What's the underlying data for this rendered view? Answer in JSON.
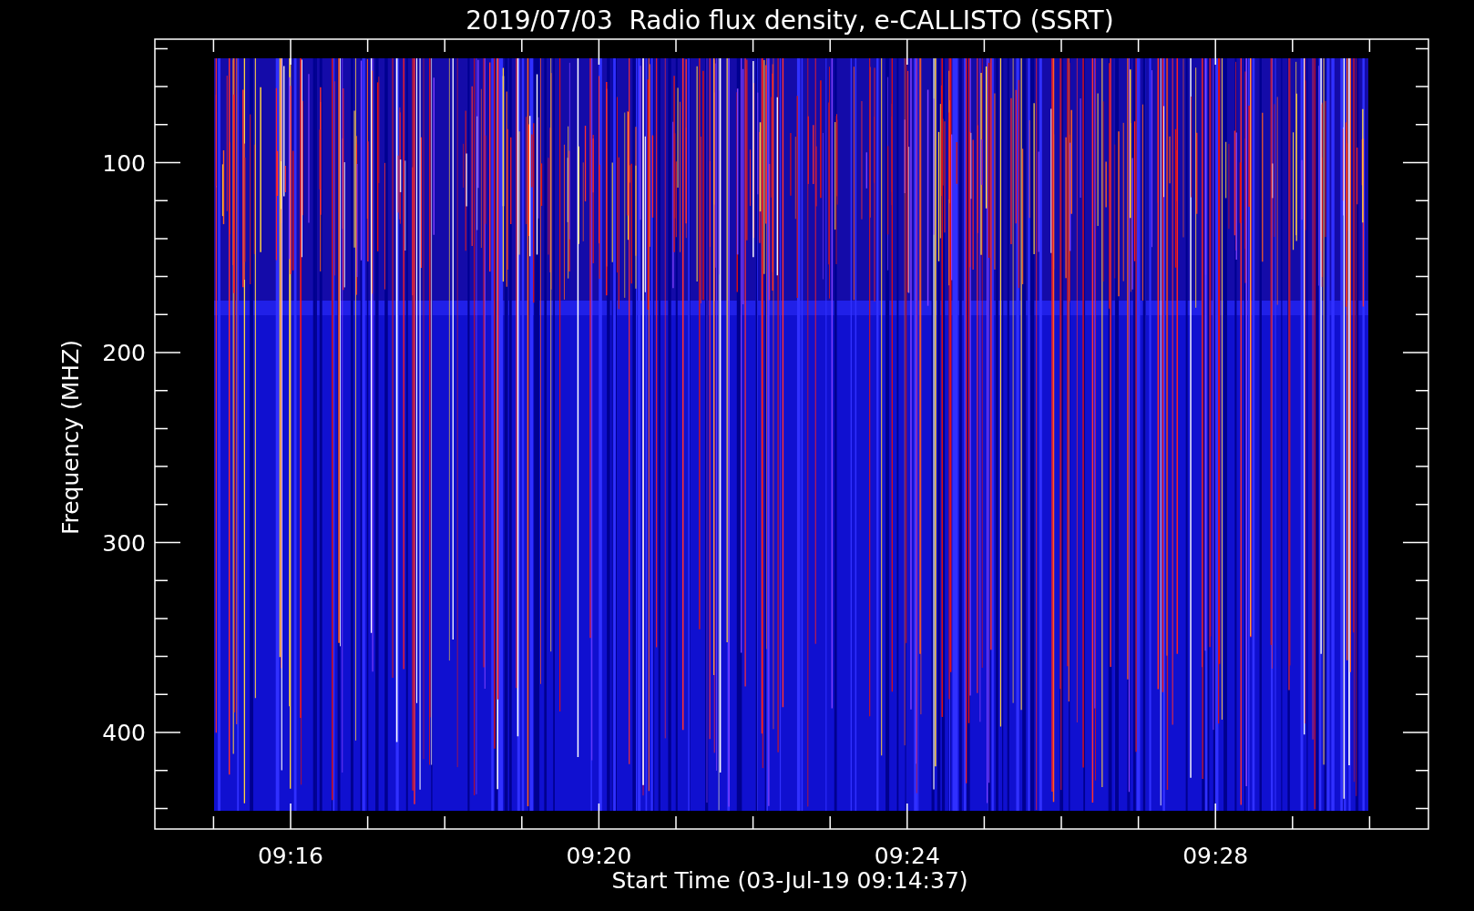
{
  "title": "2019/07/03  Radio flux density, e-CALLISTO (SSRT)",
  "y_axis": {
    "label": "Frequency (MHZ)",
    "ticks": [
      "100",
      "200",
      "300",
      "400"
    ]
  },
  "x_axis": {
    "label": "Start Time (03-Jul-19 09:14:37)",
    "ticks": [
      "09:16",
      "09:20",
      "09:24",
      "09:28"
    ]
  }
}
